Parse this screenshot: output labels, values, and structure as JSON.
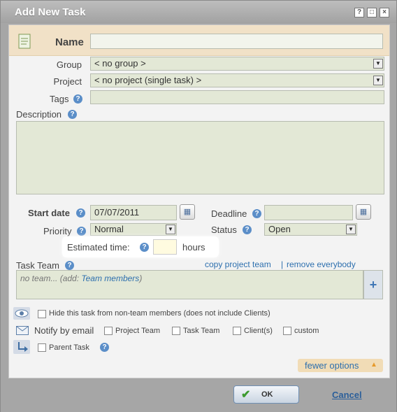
{
  "window": {
    "title": "Add New Task",
    "btn_help": "?",
    "btn_max": "□",
    "btn_close": "×"
  },
  "form": {
    "name_label": "Name",
    "name_value": "",
    "group_label": "Group",
    "group_value": "< no group >",
    "project_label": "Project",
    "project_value": "< no project (single task) >",
    "tags_label": "Tags",
    "tags_value": "",
    "description_label": "Description",
    "description_value": "",
    "start_label": "Start date",
    "start_value": "07/07/2011",
    "deadline_label": "Deadline",
    "deadline_value": "",
    "priority_label": "Priority",
    "priority_value": "Normal",
    "status_label": "Status",
    "status_value": "Open",
    "estimated_label": "Estimated time:",
    "estimated_value": "",
    "hours_label": "hours",
    "team_label": "Task Team",
    "copy_team_link": "copy project team",
    "separator": "|",
    "remove_link": "remove everybody",
    "team_placeholder": "no team... (add:",
    "team_members_link": "Team members",
    "team_close_paren": ")",
    "add_symbol": "+",
    "hide_label": "Hide this task from non-team members (does not include Clients)",
    "notify_label": "Notify by email",
    "notify_options": [
      "Project Team",
      "Task Team",
      "Client(s)",
      "custom"
    ],
    "parent_label": "Parent Task",
    "help_symbol": "?",
    "fewer_options": "fewer options"
  },
  "footer": {
    "ok_label": "OK",
    "cancel_label": "Cancel"
  },
  "colors": {
    "field_bg": "#e3e8d6",
    "name_row_bg": "#f1e1c7",
    "link": "#2d6fae",
    "accent_orange": "#e69a2b"
  }
}
